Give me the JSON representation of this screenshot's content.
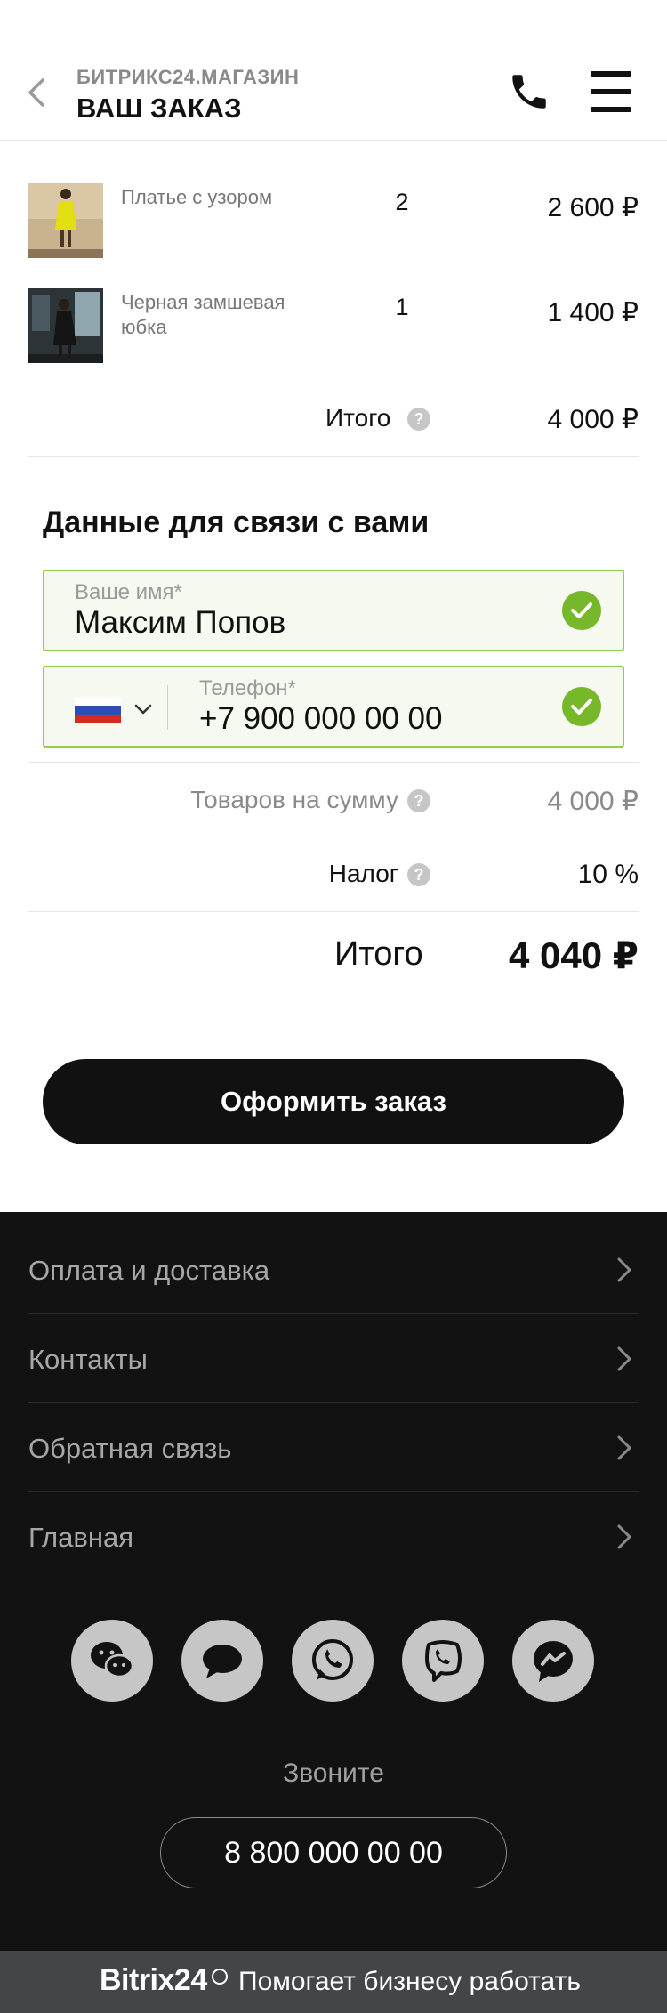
{
  "header": {
    "store_name": "БИТРИКС24.МАГАЗИН",
    "title": "ВАШ ЗАКАЗ"
  },
  "items": [
    {
      "name": "Платье с узором",
      "qty": "2",
      "price": "2 600 ₽"
    },
    {
      "name": "Черная замшевая юбка",
      "qty": "1",
      "price": "1 400 ₽"
    }
  ],
  "subtotal": {
    "label": "Итого",
    "value": "4 000 ₽"
  },
  "contact": {
    "title": "Данные для связи с вами",
    "name_label": "Ваше имя*",
    "name_value": "Максим Попов",
    "phone_label": "Телефон*",
    "phone_value": "+7 900 000 00 00"
  },
  "summary": {
    "goods_label": "Товаров на сумму",
    "goods_value": "4 000 ₽",
    "tax_label": "Налог",
    "tax_value": "10 %",
    "total_label": "Итого",
    "total_value": "4 040 ₽"
  },
  "checkout_label": "Оформить заказ",
  "footer": {
    "nav": [
      "Оплата и доставка",
      "Контакты",
      "Обратная связь",
      "Главная"
    ],
    "messengers": [
      "wechat-icon",
      "chat-icon",
      "whatsapp-icon",
      "viber-icon",
      "messenger-icon"
    ],
    "call_label": "Звоните",
    "call_number": "8 800 000 00 00",
    "brand": "Bitrix24",
    "tagline": "Помогает бизнесу работать"
  },
  "colors": {
    "accent_green": "#76b82a",
    "field_border": "#94cc4e",
    "footer_bg": "#121212",
    "button_bg": "#111111"
  }
}
